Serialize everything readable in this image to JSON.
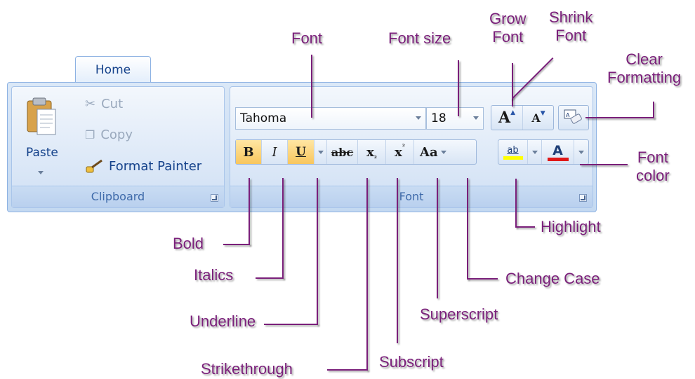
{
  "ribbon": {
    "tab_label": "Home",
    "clipboard": {
      "group_label": "Clipboard",
      "paste_label": "Paste",
      "cut_label": "Cut",
      "copy_label": "Copy",
      "format_painter_label": "Format Painter"
    },
    "font": {
      "group_label": "Font",
      "font_name": "Tahoma",
      "font_size": "18",
      "bold_glyph": "B",
      "italic_glyph": "I",
      "underline_glyph": "U",
      "strike_glyph": "abc",
      "subscript_glyph": "x",
      "superscript_glyph": "x",
      "change_case_glyph": "Aa",
      "highlight_glyph": "ab",
      "font_color_glyph": "A",
      "grow_glyph": "A",
      "shrink_glyph": "A",
      "clear_glyph": "A"
    },
    "colors": {
      "highlight": "#ffff00",
      "font_color": "#e01818",
      "active_button": "#f8c65d"
    }
  },
  "annotations": {
    "font": "Font",
    "font_size": "Font size",
    "grow_font": "Grow\nFont",
    "shrink_font": "Shrink\nFont",
    "clear_formatting": "Clear\nFormatting",
    "font_color": "Font\ncolor",
    "highlight": "Highlight",
    "change_case": "Change Case",
    "superscript": "Superscript",
    "subscript": "Subscript",
    "strikethrough": "Strikethrough",
    "underline": "Underline",
    "italics": "Italics",
    "bold": "Bold"
  }
}
